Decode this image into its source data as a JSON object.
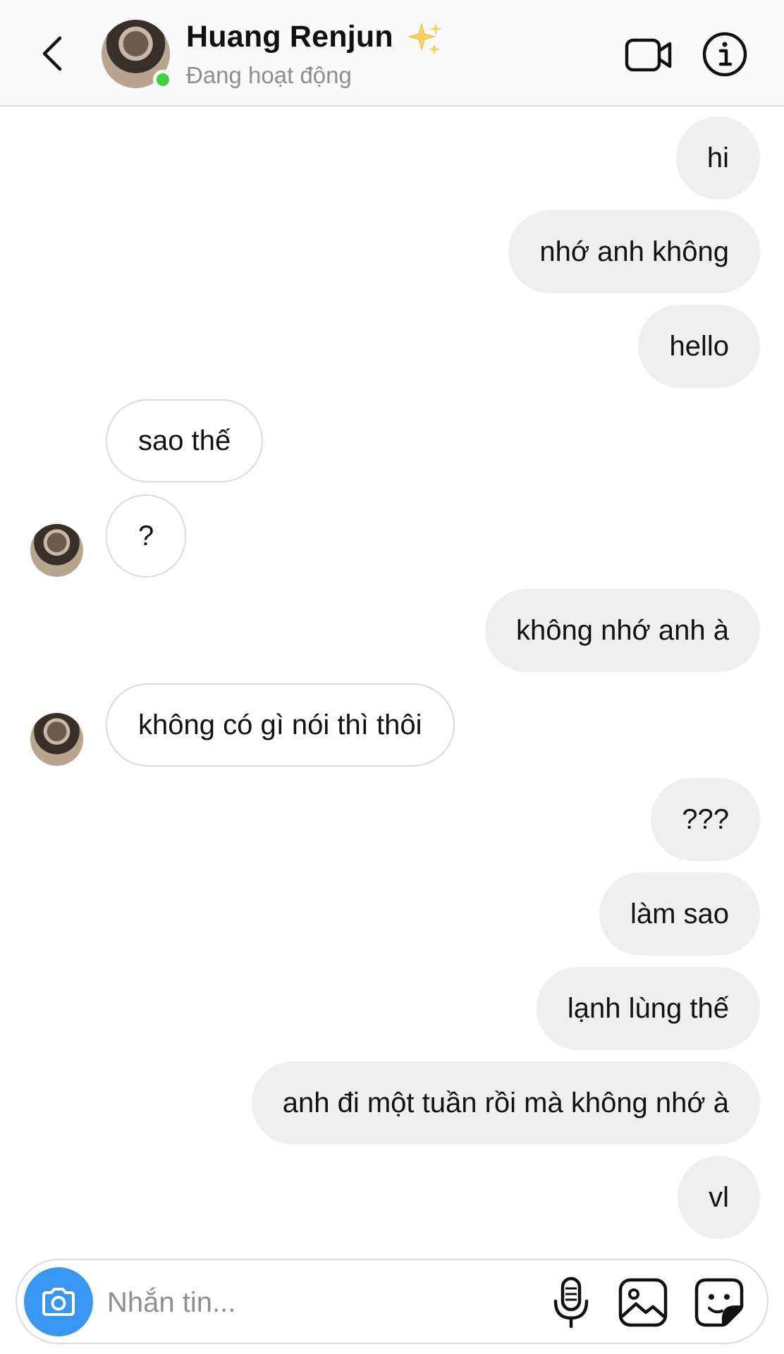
{
  "header": {
    "contact_name": "Huang Renjun",
    "status": "Đang hoạt động",
    "back_icon": "chevron-left-icon",
    "video_icon": "video-camera-icon",
    "info_icon": "info-icon",
    "online_color": "#3bd23b"
  },
  "messages": [
    {
      "text": "hi",
      "from": "me"
    },
    {
      "text": "nhớ anh không",
      "from": "me"
    },
    {
      "text": "hello",
      "from": "me"
    },
    {
      "text": "sao thế",
      "from": "them"
    },
    {
      "text": "?",
      "from": "them"
    },
    {
      "text": "không nhớ anh à",
      "from": "me"
    },
    {
      "text": "không có gì nói thì thôi",
      "from": "them"
    },
    {
      "text": "???",
      "from": "me"
    },
    {
      "text": "làm sao",
      "from": "me"
    },
    {
      "text": "lạnh lùng thế",
      "from": "me"
    },
    {
      "text": "anh đi một tuần rồi mà không nhớ à",
      "from": "me"
    },
    {
      "text": "vl",
      "from": "me"
    }
  ],
  "composer": {
    "placeholder": "Nhắn tin...",
    "camera_icon": "camera-icon",
    "mic_icon": "microphone-icon",
    "gallery_icon": "image-icon",
    "sticker_icon": "sticker-icon",
    "camera_color": "#3897f0"
  },
  "colors": {
    "sent_bubble": "#efefef",
    "received_border": "#dbdbdb",
    "secondary_text": "#8e8e8e"
  }
}
